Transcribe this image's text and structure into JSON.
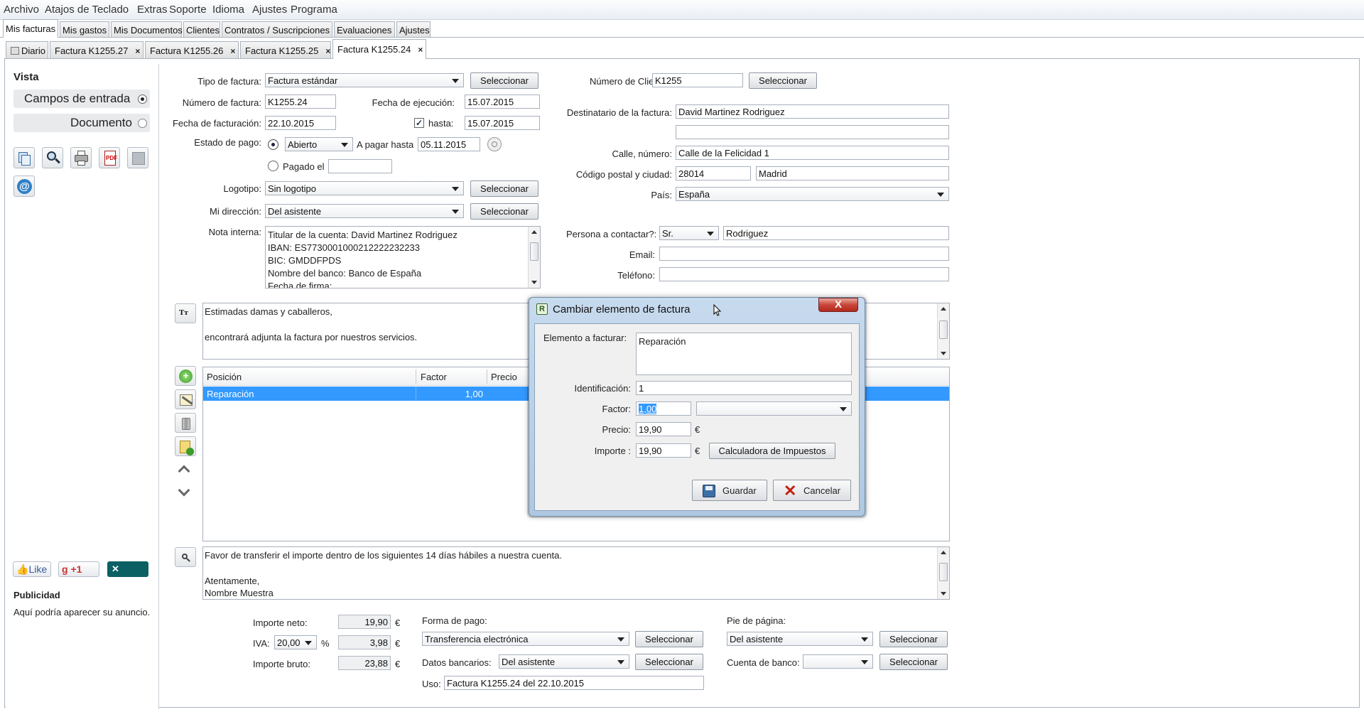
{
  "menu": [
    "Archivo",
    "Atajos de Teclado",
    "Extras",
    "Soporte",
    "Idioma",
    "Ajustes",
    "Programa"
  ],
  "main_tabs": [
    "Mis facturas",
    "Mis gastos",
    "Mis Documentos",
    "Clientes",
    "Contratos / Suscripciones",
    "Evaluaciones",
    "Ajustes"
  ],
  "doc_tabs": [
    {
      "label": "Diario"
    },
    {
      "label": "Factura K1255.27",
      "close": "×"
    },
    {
      "label": "Factura K1255.26",
      "close": "×"
    },
    {
      "label": "Factura K1255.25",
      "close": "×"
    },
    {
      "label": "Factura K1255.24",
      "close": "×"
    }
  ],
  "sidebar": {
    "vista": "Vista",
    "campos": "Campos de entrada",
    "documento": "Documento",
    "toolbar_icons": [
      "copy-icon",
      "search-icon",
      "print-icon",
      "pdf-icon",
      "save-icon",
      "email-icon"
    ],
    "social": {
      "like": "Like",
      "plus": "+1",
      "xing": "XING"
    },
    "ad_title": "Publicidad",
    "ad_text": "Aquí podría aparecer su anuncio."
  },
  "invoice": {
    "tipo_label": "Tipo de factura:",
    "tipo_value": "Factura estándar",
    "seleccionar": "Seleccionar",
    "numero_label": "Número de factura:",
    "numero_value": "K1255.24",
    "ejecucion_label": "Fecha de ejecución:",
    "ejecucion_value": "15.07.2015",
    "facturacion_label": "Fecha de facturación:",
    "facturacion_value": "22.10.2015",
    "hasta_label": "hasta:",
    "hasta_value": "15.07.2015",
    "estado_label": "Estado de pago:",
    "estado_value": "Abierto",
    "apagar_label": "A pagar hasta",
    "apagar_value": "05.11.2015",
    "pagado_label": "Pagado el",
    "pagado_value": "",
    "logotipo_label": "Logotipo:",
    "logotipo_value": "Sin logotipo",
    "direccion_label": "Mi dirección:",
    "direccion_value": "Del asistente",
    "nota_label": "Nota interna:",
    "nota_lines": [
      "Titular de la cuenta: David Martinez Rodriguez",
      "IBAN: ES7730001000212222232233",
      "BIC: GMDDFPDS",
      "Nombre del banco: Banco de España",
      "Fecha de firma:"
    ]
  },
  "client": {
    "numero_label": "Número de Cliente:",
    "numero_value": "K1255",
    "destinatario_label": "Destinatario de la factura:",
    "destinatario_value": "David Martinez Rodriguez",
    "destinatario2_value": "",
    "calle_label": "Calle, número:",
    "calle_value": "Calle de la Felicidad 1",
    "cp_label": "Código postal y ciudad:",
    "cp_value": "28014",
    "ciudad_value": "Madrid",
    "pais_label": "País:",
    "pais_value": "España",
    "contacto_label": "Persona a contactar?:",
    "contacto_title": "Sr.",
    "contacto_name": "Rodriguez",
    "email_label": "Email:",
    "email_value": "",
    "telefono_label": "Teléfono:",
    "telefono_value": ""
  },
  "intro_text": [
    "Estimadas damas y caballeros,",
    "encontrará adjunta la factura por nuestros servicios."
  ],
  "positions": {
    "headers": [
      "Posición",
      "Factor",
      "Precio"
    ],
    "rows": [
      {
        "posicion": "Reparación",
        "factor": "1,00"
      }
    ]
  },
  "closing_text": [
    "Favor de transferir el importe dentro de los siguientes 14 días hábiles a nuestra cuenta.",
    "Atentamente,",
    "Nombre Muestra"
  ],
  "totals": {
    "neto_label": "Importe neto:",
    "neto_value": "19,90",
    "iva_label": "IVA:",
    "iva_rate": "20,00",
    "percent": "%",
    "iva_value": "3,98",
    "bruto_label": "Importe bruto:",
    "bruto_value": "23,88",
    "currency": "€"
  },
  "payment": {
    "forma_label": "Forma de pago:",
    "forma_value": "Transferencia electrónica",
    "bancarios_label": "Datos bancarios:",
    "bancarios_value": "Del asistente",
    "uso_label": "Uso:",
    "uso_value": "Factura K1255.24 del 22.10.2015",
    "pie_label": "Pie de página:",
    "pie_value": "Del asistente",
    "cuenta_label": "Cuenta de banco:",
    "cuenta_value": ""
  },
  "dialog": {
    "title": "Cambiar elemento de factura",
    "close": "X",
    "elemento_label": "Elemento a facturar:",
    "elemento_value": "Reparación",
    "ident_label": "Identificación:",
    "ident_value": "1",
    "factor_label": "Factor:",
    "factor_value": "1,00",
    "factor_unit": "",
    "precio_label": "Precio:",
    "precio_value": "19,90",
    "importe_label": "Importe :",
    "importe_value": "19,90",
    "currency": "€",
    "calc_button": "Calculadora de Impuestos",
    "save_button": "Guardar",
    "cancel_button": "Cancelar"
  }
}
